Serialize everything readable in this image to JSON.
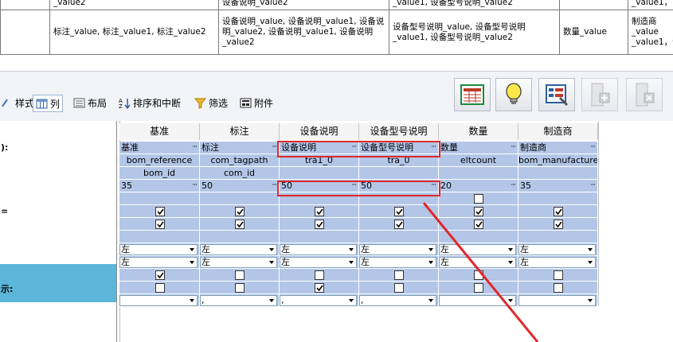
{
  "preview": {
    "rows": [
      [
        "",
        "_value2",
        "设备说明_value2",
        "_value1, 设备型号说明_value2",
        "",
        "_value1，"
      ],
      [
        "",
        "标注_value, 标注_value1, 标注_value2",
        "设备说明_value, 设备说明_value1, 设备说明_value2, 设备说明_value1, 设备说明_value2",
        "设备型号说明_value, 设备型号说明_value1, 设备型号说明_value2",
        "数量_value",
        "制造商_value _value1，设"
      ]
    ]
  },
  "toolbar": {
    "tabs": [
      {
        "label": "样式",
        "icon": "style-icon"
      },
      {
        "label": "列",
        "icon": "columns-icon",
        "active": true
      },
      {
        "label": "布局",
        "icon": "layout-icon"
      },
      {
        "label": "排序和中断",
        "icon": "sort-icon"
      },
      {
        "label": "筛选",
        "icon": "filter-icon"
      },
      {
        "label": "附件",
        "icon": "attachment-icon"
      }
    ],
    "buttons": [
      "table-icon",
      "lightbulb-icon",
      "properties-icon",
      "insert-column-icon",
      "delete-column-icon"
    ]
  },
  "grid": {
    "row_labels": [
      {
        "text": "): ",
        "row": 1
      },
      {
        "text": "=",
        "row": 6
      },
      {
        "text": "",
        "row": 10
      },
      {
        "text": "示:",
        "row": 12
      },
      {
        "text": "",
        "row": 13
      }
    ],
    "columns": [
      {
        "header": "基准",
        "name": "基准",
        "field": "bom_reference",
        "id": "bom_id",
        "width": "35",
        "chk_a": true,
        "chk_b": true,
        "chk_c": false,
        "align1": "左",
        "align2": "左",
        "chk_d": true,
        "chk_e": false,
        "sep": ""
      },
      {
        "header": "标注",
        "name": "标注",
        "field": "com_tagpath",
        "id": "com_id",
        "width": "50",
        "chk_a": true,
        "chk_b": true,
        "chk_c": false,
        "align1": "左",
        "align2": "左",
        "chk_d": false,
        "chk_e": false,
        "sep": ","
      },
      {
        "header": "设备说明",
        "name": "设备说明",
        "field": "tra1_0",
        "id": "",
        "width": "50",
        "chk_a": true,
        "chk_b": true,
        "chk_c": false,
        "align1": "左",
        "align2": "左",
        "chk_d": false,
        "chk_e": true,
        "sep": ","
      },
      {
        "header": "设备型号说明",
        "name": "设备型号说明",
        "field": "tra_0",
        "id": "",
        "width": "50",
        "chk_a": true,
        "chk_b": true,
        "chk_c": false,
        "align1": "左",
        "align2": "左",
        "chk_d": false,
        "chk_e": false,
        "sep": ","
      },
      {
        "header": "数量",
        "name": "数量",
        "field": "eltcount",
        "id": "",
        "width": "20",
        "chk_a": true,
        "chk_b": true,
        "chk_c": false,
        "align1": "左",
        "align2": "左",
        "chk_d": false,
        "chk_e": false,
        "sep": ""
      },
      {
        "header": "制造商",
        "name": "制造商",
        "field": "bom_manufacturer",
        "id": "",
        "width": "35",
        "chk_a": true,
        "chk_b": true,
        "chk_c": false,
        "align1": "左",
        "align2": "左",
        "chk_d": false,
        "chk_e": false,
        "sep": ""
      }
    ]
  },
  "annotation_color": "#e0282b",
  "cell_color": "#b3c6e7",
  "highlight_label_color": "#5cb6d9"
}
